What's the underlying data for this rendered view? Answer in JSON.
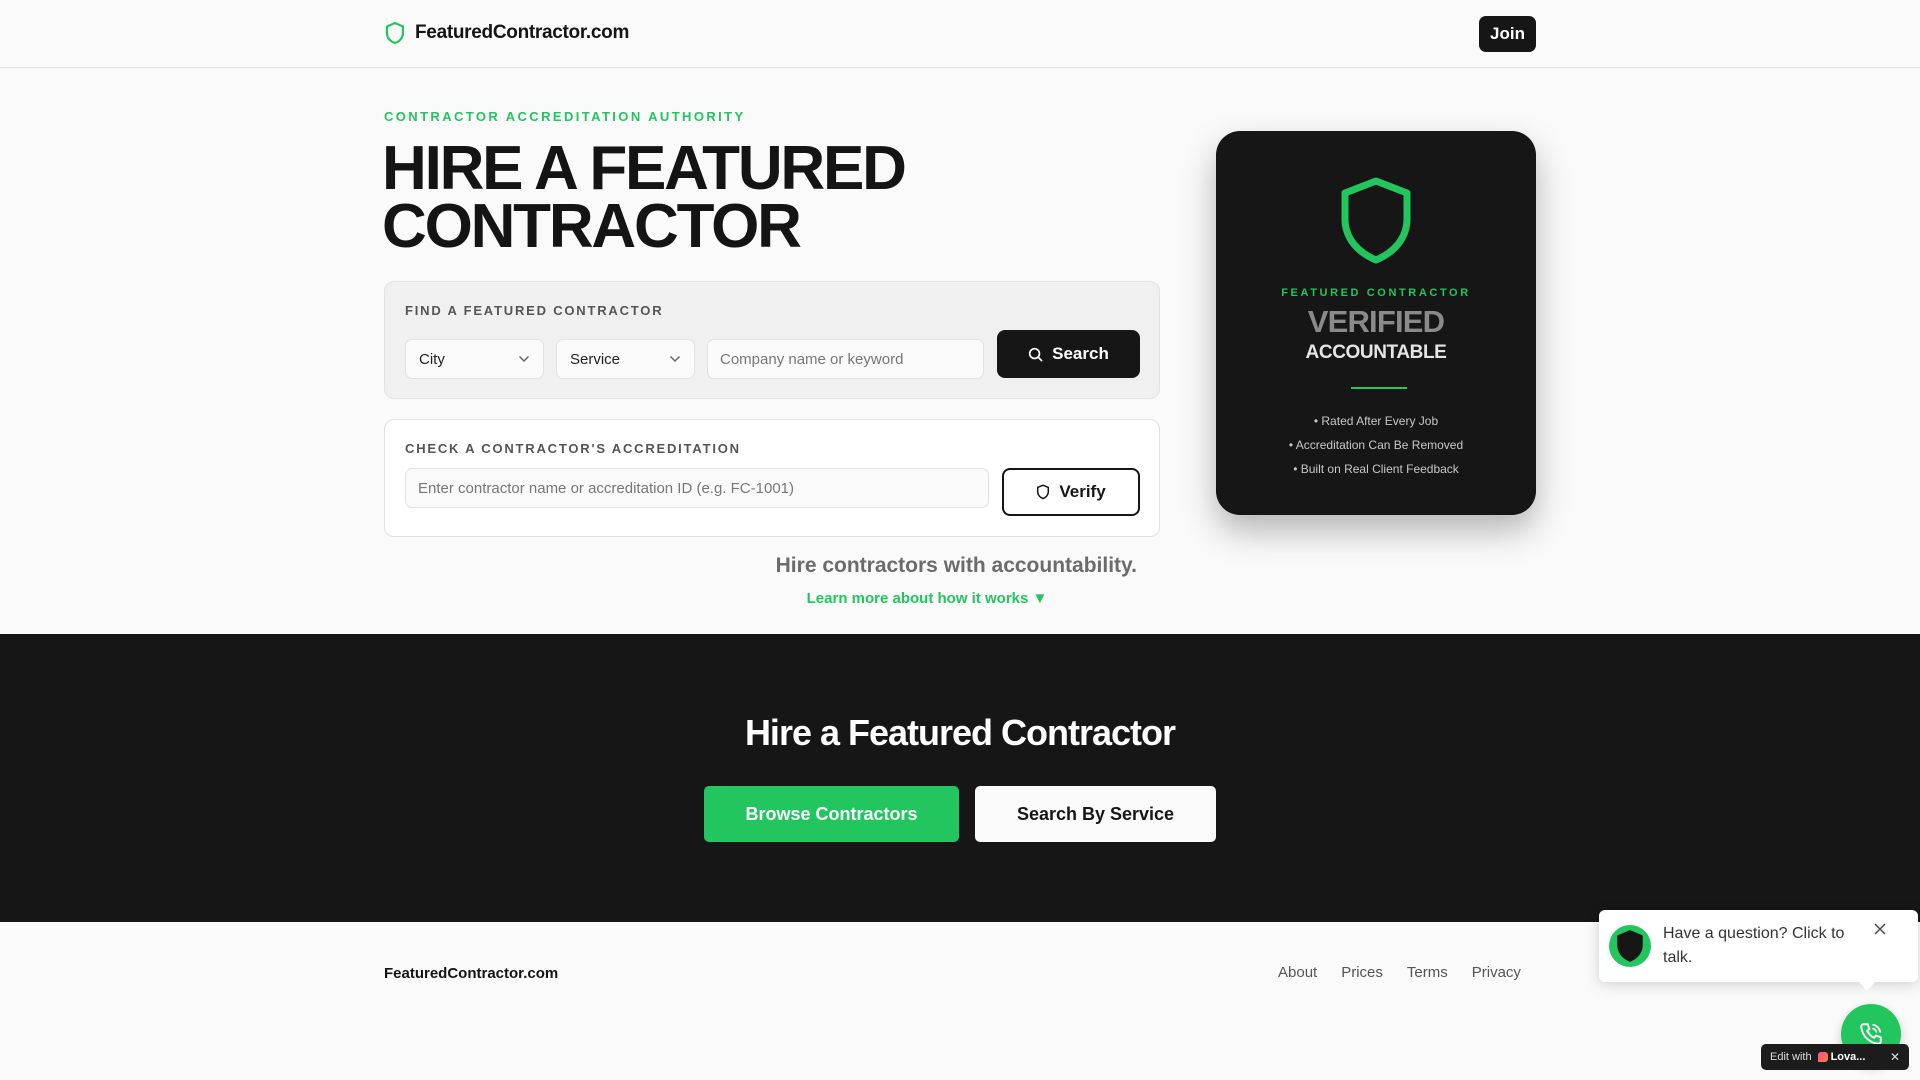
{
  "header": {
    "brand": "FeaturedContractor.com",
    "join_label": "Join"
  },
  "hero": {
    "eyebrow": "CONTRACTOR ACCREDITATION AUTHORITY",
    "title_line1": "HIRE A FEATURED",
    "title_line2": "CONTRACTOR"
  },
  "find": {
    "label": "FIND A FEATURED CONTRACTOR",
    "city_value": "City",
    "service_value": "Service",
    "keyword_placeholder": "Company name or keyword",
    "search_label": "Search"
  },
  "accreditation": {
    "label": "CHECK A CONTRACTOR'S ACCREDITATION",
    "input_placeholder": "Enter contractor name or accreditation ID (e.g. FC-1001)",
    "verify_label": "Verify"
  },
  "tagline": "Hire contractors with accountability.",
  "learn_more": "Learn more about how it works ▼",
  "badge": {
    "eyebrow": "FEATURED CONTRACTOR",
    "verified": "VERIFIED",
    "accountable": "ACCOUNTABLE",
    "points": [
      "• Rated After Every Job",
      "• Accreditation Can Be Removed",
      "• Built on Real Client Feedback"
    ]
  },
  "cta": {
    "title": "Hire a Featured Contractor",
    "browse_label": "Browse Contractors",
    "service_label": "Search By Service"
  },
  "footer": {
    "brand": "FeaturedContractor.com",
    "links": [
      "About",
      "Prices",
      "Terms",
      "Privacy"
    ]
  },
  "chat": {
    "message": "Have a question? Click to talk."
  },
  "edit_badge": {
    "prefix": "Edit with",
    "brand": "Lova..."
  },
  "colors": {
    "accent": "#22c55e",
    "dark": "#161616",
    "background": "#fafafa"
  },
  "icons": [
    "shield-icon",
    "chevron-down-icon",
    "search-icon",
    "phone-icon",
    "close-icon"
  ]
}
